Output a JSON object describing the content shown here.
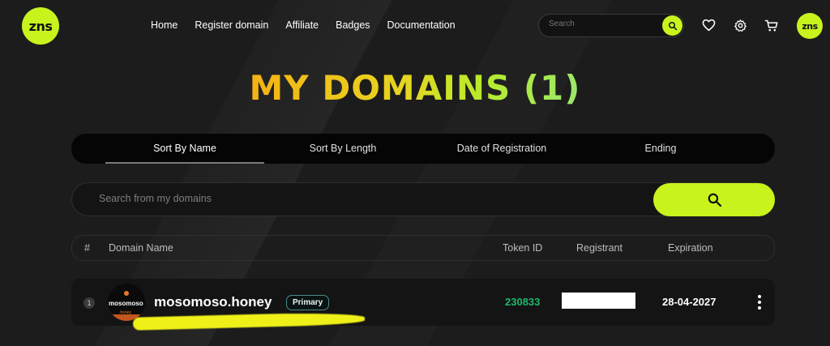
{
  "header": {
    "logo": "zns",
    "nav": [
      {
        "label": "Home"
      },
      {
        "label": "Register domain"
      },
      {
        "label": "Affiliate"
      },
      {
        "label": "Badges"
      },
      {
        "label": "Documentation"
      }
    ],
    "search_placeholder": "Search",
    "icons": [
      "search-icon",
      "heart-icon",
      "gear-icon",
      "cart-icon"
    ],
    "avatar": "zns"
  },
  "page_title": "MY DOMAINS (1)",
  "sort_tabs": [
    {
      "label": "Sort By Name",
      "active": true
    },
    {
      "label": "Sort By Length",
      "active": false
    },
    {
      "label": "Date of Registration",
      "active": false
    },
    {
      "label": "Ending",
      "active": false
    }
  ],
  "domain_search": {
    "placeholder": "Search from my domains"
  },
  "table": {
    "columns": [
      "#",
      "Domain Name",
      "Token ID",
      "Registrant",
      "Expiration"
    ],
    "rows": [
      {
        "index": "1",
        "thumb_name": "mosomoso",
        "thumb_tld": ".honey",
        "domain": "mosomoso.honey",
        "badge": "Primary",
        "token_id": "230833",
        "registrant": "",
        "expiration": "28-04-2027"
      }
    ]
  },
  "colors": {
    "accent": "#c8f31d",
    "background": "#1c1c1c",
    "token_green": "#1cb86a"
  }
}
